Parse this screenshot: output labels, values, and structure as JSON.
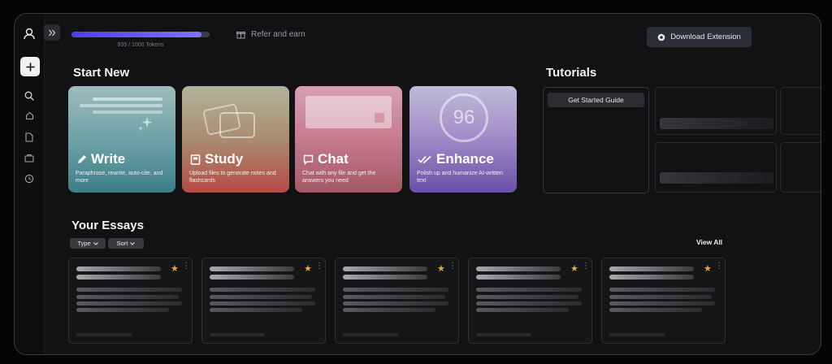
{
  "tokens": {
    "text": "939 / 1000 Tokens",
    "used": 939,
    "total": 1000,
    "fraction": 0.939
  },
  "header": {
    "refer_label": "Refer and earn",
    "download_label": "Download Extension"
  },
  "start_new": {
    "heading": "Start New",
    "cards": [
      {
        "title": "Write",
        "desc": "Paraphrase, rewrite, auto-cite, and more",
        "icon": "pencil-icon"
      },
      {
        "title": "Study",
        "desc": "Upload files to generate notes and flashcards",
        "icon": "notebook-icon"
      },
      {
        "title": "Chat",
        "desc": "Chat with any file and get the answers you need",
        "icon": "chat-bubble-icon"
      },
      {
        "title": "Enhance",
        "desc": "Polish up and humanize AI-written text",
        "icon": "double-check-icon",
        "score": "96"
      }
    ]
  },
  "tutorials": {
    "heading": "Tutorials",
    "guide_label": "Get Started Guide"
  },
  "essays": {
    "heading": "Your Essays",
    "filters": {
      "type": "Type",
      "sort": "Sort"
    },
    "view_all": "View All",
    "count": 5
  },
  "colors": {
    "accent": "#5b4cf2",
    "star": "#e6a93a",
    "background": "#121214"
  }
}
